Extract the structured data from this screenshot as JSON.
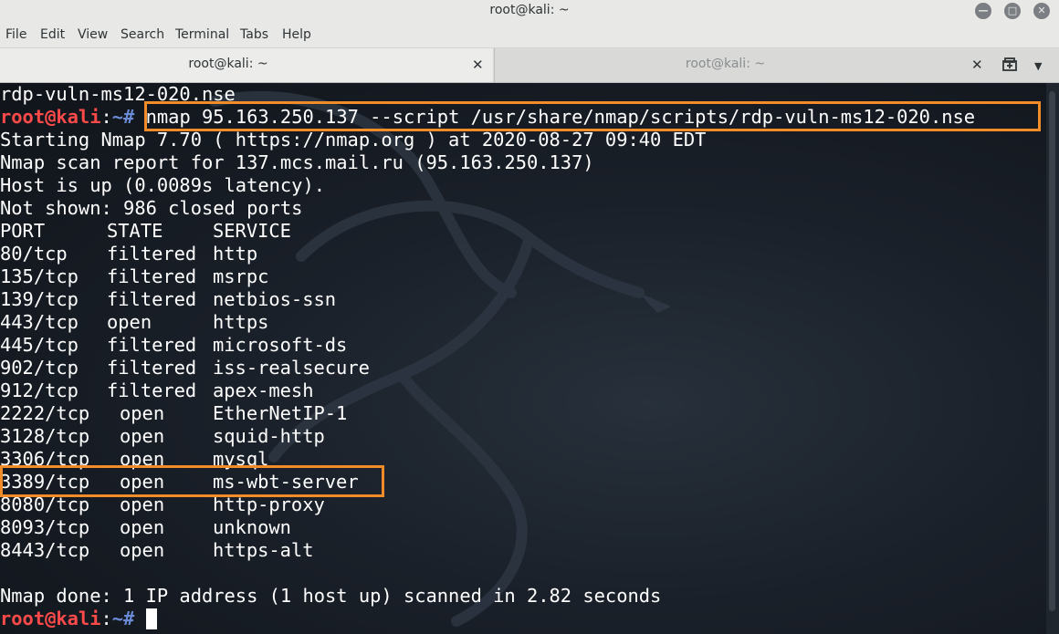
{
  "window": {
    "title": "root@kali: ~"
  },
  "menu": [
    "File",
    "Edit",
    "View",
    "Search",
    "Terminal",
    "Tabs",
    "Help"
  ],
  "tabs": [
    {
      "label": "root@kali: ~"
    },
    {
      "label": "root@kali: ~"
    }
  ],
  "prompt": {
    "user": "root@kali",
    "sep": ":",
    "path": "~#"
  },
  "terminal": {
    "prev_line": "rdp-vuln-ms12-020.nse",
    "command": " nmap 95.163.250.137 --script /usr/share/nmap/scripts/rdp-vuln-ms12-020.nse",
    "output": [
      "Starting Nmap 7.70 ( https://nmap.org ) at 2020-08-27 09:40 EDT",
      "Nmap scan report for 137.mcs.mail.ru (95.163.250.137)",
      "Host is up (0.0089s latency).",
      "Not shown: 986 closed ports"
    ],
    "table_header": [
      "PORT",
      "STATE",
      "SERVICE"
    ],
    "ports": [
      [
        "80/tcp",
        "filtered",
        "http"
      ],
      [
        "135/tcp",
        "filtered",
        "msrpc"
      ],
      [
        "139/tcp",
        "filtered",
        "netbios-ssn"
      ],
      [
        "443/tcp",
        "open",
        "https"
      ],
      [
        "445/tcp",
        "filtered",
        "microsoft-ds"
      ],
      [
        "902/tcp",
        "filtered",
        "iss-realsecure"
      ],
      [
        "912/tcp",
        "filtered",
        "apex-mesh"
      ],
      [
        "2222/tcp",
        "open",
        "EtherNetIP-1"
      ],
      [
        "3128/tcp",
        "open",
        "squid-http"
      ],
      [
        "3306/tcp",
        "open",
        "mysql"
      ],
      [
        "3389/tcp",
        "open",
        "ms-wbt-server"
      ],
      [
        "8080/tcp",
        "open",
        "http-proxy"
      ],
      [
        "8093/tcp",
        "open",
        "unknown"
      ],
      [
        "8443/tcp",
        "open",
        "https-alt"
      ]
    ],
    "done_line": "Nmap done: 1 IP address (1 host up) scanned in 2.82 seconds"
  },
  "colors": {
    "highlight": "#f28c28",
    "prompt_user": "#ff4a4a",
    "prompt_path": "#6b8bd6"
  }
}
